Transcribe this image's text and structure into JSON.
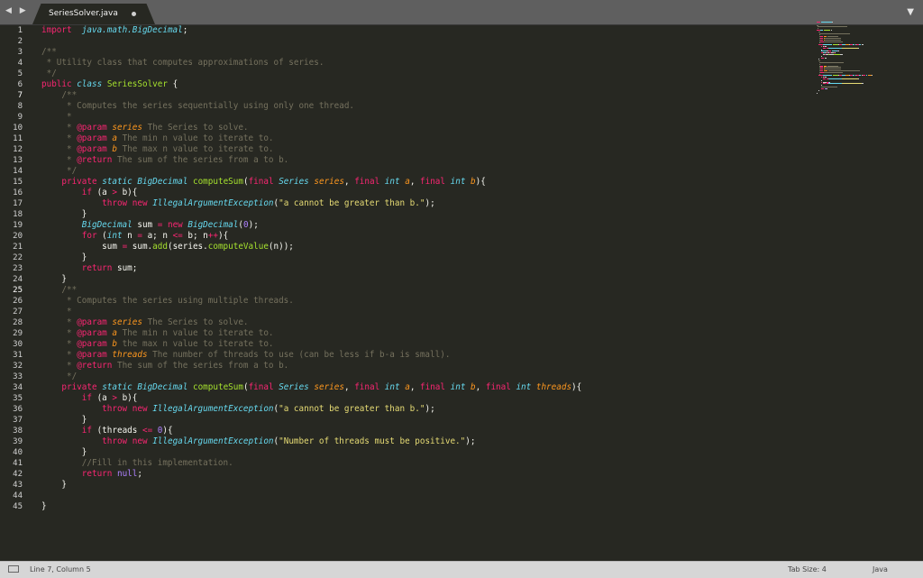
{
  "tab": {
    "title": "SeriesSolver.java",
    "nav_arrows": "◀ ▶",
    "menu_caret": "▼"
  },
  "gutter": {
    "line_numbers": [
      "1",
      "2",
      "3",
      "4",
      "5",
      "6",
      "7",
      "8",
      "9",
      "10",
      "11",
      "12",
      "13",
      "14",
      "15",
      "16",
      "17",
      "18",
      "19",
      "20",
      "21",
      "22",
      "23",
      "24",
      "25",
      "26",
      "27",
      "28",
      "29",
      "30",
      "31",
      "32",
      "33",
      "34",
      "35",
      "36",
      "37",
      "38",
      "39",
      "40",
      "41",
      "42",
      "43",
      "44",
      "45"
    ],
    "modified_lines": [
      7,
      25
    ]
  },
  "code": {
    "lines": [
      [
        [
          "kw",
          "import"
        ],
        [
          "",
          "  "
        ],
        [
          "st",
          "java.math.BigDecimal"
        ],
        [
          "",
          ";"
        ]
      ],
      [],
      [
        [
          "cm",
          "/**"
        ]
      ],
      [
        [
          "cm",
          " * Utility class that computes approximations of series."
        ]
      ],
      [
        [
          "cm",
          " */"
        ]
      ],
      [
        [
          "kw",
          "public"
        ],
        [
          "",
          " "
        ],
        [
          "st",
          "class"
        ],
        [
          "",
          " "
        ],
        [
          "fn",
          "SeriesSolver"
        ],
        [
          "",
          " {"
        ]
      ],
      [
        [
          "",
          ""
        ],
        [
          "cm",
          "    /**"
        ]
      ],
      [
        [
          "cm",
          "     * Computes the series sequentially using only one thread."
        ]
      ],
      [
        [
          "cm",
          "     *"
        ]
      ],
      [
        [
          "cm",
          "     * "
        ],
        [
          "tg",
          "@param"
        ],
        [
          "",
          " "
        ],
        [
          "pa",
          "series"
        ],
        [
          "cm",
          " The Series to solve."
        ]
      ],
      [
        [
          "cm",
          "     * "
        ],
        [
          "tg",
          "@param"
        ],
        [
          "",
          " "
        ],
        [
          "pa",
          "a"
        ],
        [
          "cm",
          " The min n value to iterate to."
        ]
      ],
      [
        [
          "cm",
          "     * "
        ],
        [
          "tg",
          "@param"
        ],
        [
          "",
          " "
        ],
        [
          "pa",
          "b"
        ],
        [
          "cm",
          " The max n value to iterate to."
        ]
      ],
      [
        [
          "cm",
          "     * "
        ],
        [
          "tg",
          "@return"
        ],
        [
          "cm",
          " The sum of the series from a to b."
        ]
      ],
      [
        [
          "cm",
          "     */"
        ]
      ],
      [
        [
          "",
          "    "
        ],
        [
          "kw",
          "private"
        ],
        [
          "",
          " "
        ],
        [
          "st",
          "static"
        ],
        [
          "",
          " "
        ],
        [
          "ty",
          "BigDecimal"
        ],
        [
          "",
          " "
        ],
        [
          "fn",
          "computeSum"
        ],
        [
          "",
          "("
        ],
        [
          "kw",
          "final"
        ],
        [
          "",
          " "
        ],
        [
          "ty",
          "Series"
        ],
        [
          "",
          " "
        ],
        [
          "pa",
          "series"
        ],
        [
          ", "
        ],
        [
          "kw",
          "final"
        ],
        [
          "",
          " "
        ],
        [
          "ty",
          "int"
        ],
        [
          "",
          " "
        ],
        [
          "pa",
          "a"
        ],
        [
          "",
          ", "
        ],
        [
          "kw",
          "final"
        ],
        [
          "",
          " "
        ],
        [
          "ty",
          "int"
        ],
        [
          "",
          " "
        ],
        [
          "pa",
          "b"
        ],
        [
          "",
          "){"
        ]
      ],
      [
        [
          "",
          "        "
        ],
        [
          "kw",
          "if"
        ],
        [
          "",
          " (a "
        ],
        [
          "op",
          ">"
        ],
        [
          "",
          " b){"
        ]
      ],
      [
        [
          "",
          "            "
        ],
        [
          "kw",
          "throw"
        ],
        [
          "",
          " "
        ],
        [
          "kw",
          "new"
        ],
        [
          "",
          " "
        ],
        [
          "ty",
          "IllegalArgumentException"
        ],
        [
          "",
          "("
        ],
        [
          "sr",
          "\"a cannot be greater than b.\""
        ],
        [
          "",
          ");"
        ]
      ],
      [
        [
          "",
          "        }"
        ]
      ],
      [
        [
          "",
          "        "
        ],
        [
          "ty",
          "BigDecimal"
        ],
        [
          "",
          " sum "
        ],
        [
          "op",
          "="
        ],
        [
          "",
          " "
        ],
        [
          "kw",
          "new"
        ],
        [
          "",
          " "
        ],
        [
          "ty",
          "BigDecimal"
        ],
        [
          "",
          "("
        ],
        [
          "nm",
          "0"
        ],
        [
          "",
          ");"
        ]
      ],
      [
        [
          "",
          "        "
        ],
        [
          "kw",
          "for"
        ],
        [
          "",
          " ("
        ],
        [
          "ty",
          "int"
        ],
        [
          "",
          " n "
        ],
        [
          "op",
          "="
        ],
        [
          "",
          " a; n "
        ],
        [
          "op",
          "<="
        ],
        [
          "",
          " b; n"
        ],
        [
          "op",
          "++"
        ],
        [
          "",
          "){"
        ]
      ],
      [
        [
          "",
          "            sum "
        ],
        [
          "op",
          "="
        ],
        [
          "",
          " sum."
        ],
        [
          "fn",
          "add"
        ],
        [
          "",
          "(series."
        ],
        [
          "fn",
          "computeValue"
        ],
        [
          "",
          "(n));"
        ]
      ],
      [
        [
          "",
          "        }"
        ]
      ],
      [
        [
          "",
          "        "
        ],
        [
          "kw",
          "return"
        ],
        [
          "",
          " sum;"
        ]
      ],
      [
        [
          "",
          "    }"
        ]
      ],
      [
        [
          "cm",
          "    /**"
        ]
      ],
      [
        [
          "cm",
          "     * Computes the series using multiple threads."
        ]
      ],
      [
        [
          "cm",
          "     *"
        ]
      ],
      [
        [
          "cm",
          "     * "
        ],
        [
          "tg",
          "@param"
        ],
        [
          "",
          " "
        ],
        [
          "pa",
          "series"
        ],
        [
          "cm",
          " The Series to solve."
        ]
      ],
      [
        [
          "cm",
          "     * "
        ],
        [
          "tg",
          "@param"
        ],
        [
          "",
          " "
        ],
        [
          "pa",
          "a"
        ],
        [
          "cm",
          " The min n value to iterate to."
        ]
      ],
      [
        [
          "cm",
          "     * "
        ],
        [
          "tg",
          "@param"
        ],
        [
          "",
          " "
        ],
        [
          "pa",
          "b"
        ],
        [
          "cm",
          " the max n value to iterate to."
        ]
      ],
      [
        [
          "cm",
          "     * "
        ],
        [
          "tg",
          "@param"
        ],
        [
          "",
          " "
        ],
        [
          "pa",
          "threads"
        ],
        [
          "cm",
          " The number of threads to use (can be less if b-a is small)."
        ]
      ],
      [
        [
          "cm",
          "     * "
        ],
        [
          "tg",
          "@return"
        ],
        [
          "cm",
          " The sum of the series from a to b."
        ]
      ],
      [
        [
          "cm",
          "     */"
        ]
      ],
      [
        [
          "",
          "    "
        ],
        [
          "kw",
          "private"
        ],
        [
          "",
          " "
        ],
        [
          "st",
          "static"
        ],
        [
          "",
          " "
        ],
        [
          "ty",
          "BigDecimal"
        ],
        [
          "",
          " "
        ],
        [
          "fn",
          "computeSum"
        ],
        [
          "",
          "("
        ],
        [
          "kw",
          "final"
        ],
        [
          "",
          " "
        ],
        [
          "ty",
          "Series"
        ],
        [
          "",
          " "
        ],
        [
          "pa",
          "series"
        ],
        [
          "",
          ", "
        ],
        [
          "kw",
          "final"
        ],
        [
          "",
          " "
        ],
        [
          "ty",
          "int"
        ],
        [
          "",
          " "
        ],
        [
          "pa",
          "a"
        ],
        [
          "",
          ", "
        ],
        [
          "kw",
          "final"
        ],
        [
          "",
          " "
        ],
        [
          "ty",
          "int"
        ],
        [
          "",
          " "
        ],
        [
          "pa",
          "b"
        ],
        [
          "",
          ", "
        ],
        [
          "kw",
          "final"
        ],
        [
          "",
          " "
        ],
        [
          "ty",
          "int"
        ],
        [
          "",
          " "
        ],
        [
          "pa",
          "threads"
        ],
        [
          "",
          "){"
        ]
      ],
      [
        [
          "",
          "        "
        ],
        [
          "kw",
          "if"
        ],
        [
          "",
          " (a "
        ],
        [
          "op",
          ">"
        ],
        [
          "",
          " b){"
        ]
      ],
      [
        [
          "",
          "            "
        ],
        [
          "kw",
          "throw"
        ],
        [
          "",
          " "
        ],
        [
          "kw",
          "new"
        ],
        [
          "",
          " "
        ],
        [
          "ty",
          "IllegalArgumentException"
        ],
        [
          "",
          "("
        ],
        [
          "sr",
          "\"a cannot be greater than b.\""
        ],
        [
          "",
          ");"
        ]
      ],
      [
        [
          "",
          "        }"
        ]
      ],
      [
        [
          "",
          "        "
        ],
        [
          "kw",
          "if"
        ],
        [
          "",
          " (threads "
        ],
        [
          "op",
          "<="
        ],
        [
          "",
          " "
        ],
        [
          "nm",
          "0"
        ],
        [
          "",
          "){"
        ]
      ],
      [
        [
          "",
          "            "
        ],
        [
          "kw",
          "throw"
        ],
        [
          "",
          " "
        ],
        [
          "kw",
          "new"
        ],
        [
          "",
          " "
        ],
        [
          "ty",
          "IllegalArgumentException"
        ],
        [
          "",
          "("
        ],
        [
          "sr",
          "\"Number of threads must be positive.\""
        ],
        [
          "",
          ");"
        ]
      ],
      [
        [
          "",
          "        }"
        ]
      ],
      [
        [
          "cm",
          "        //Fill in this implementation."
        ]
      ],
      [
        [
          "",
          "        "
        ],
        [
          "kw",
          "return"
        ],
        [
          "",
          " "
        ],
        [
          "nm",
          "null"
        ],
        [
          "",
          ";"
        ]
      ],
      [
        [
          "",
          "    }"
        ]
      ],
      [],
      [
        [
          "",
          "}"
        ]
      ]
    ]
  },
  "status": {
    "position": "Line 7, Column 5",
    "tab_size": "Tab Size: 4",
    "language": "Java"
  },
  "colors": {
    "background": "#272822",
    "tabbar": "#5f5f5f",
    "statusbar": "#d6d6d6",
    "keyword": "#f92672",
    "type": "#66d9ef",
    "function": "#a6e22e",
    "param": "#fd971f",
    "string": "#e6db74",
    "number": "#ae81ff",
    "comment": "#75715e"
  }
}
